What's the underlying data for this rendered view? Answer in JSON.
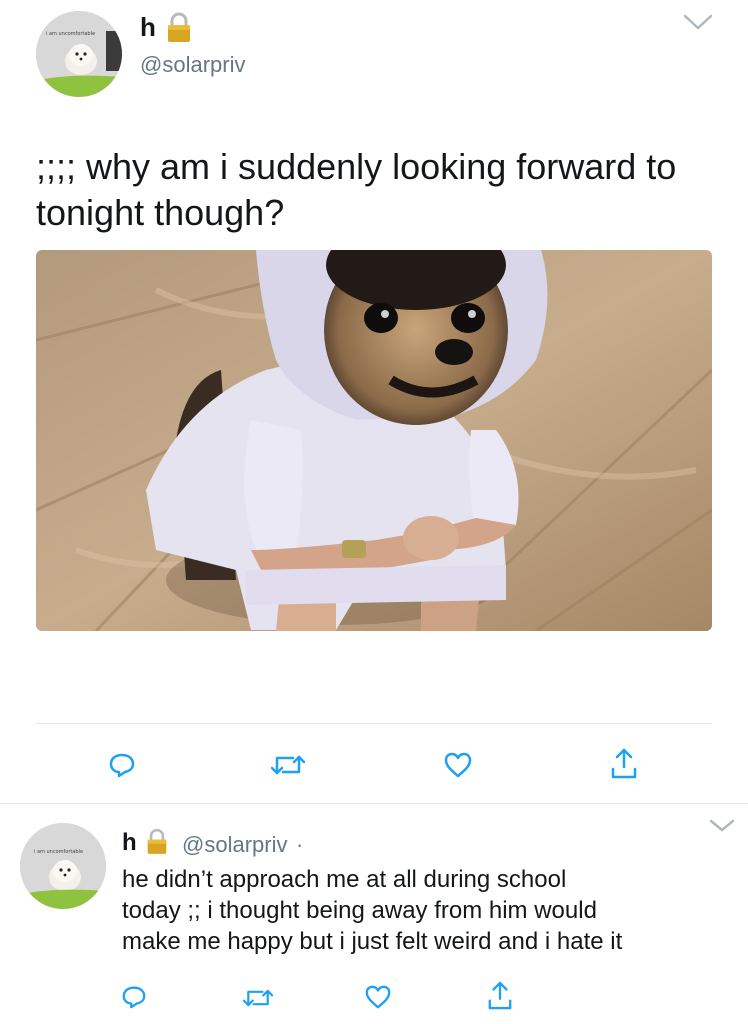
{
  "main_tweet": {
    "display_name": "h",
    "handle": "@solarpriv",
    "avatar_caption": "i am uncomfortable",
    "text_line1": ";;;; why am i suddenly looking forward to",
    "text_line2": "tonight though?",
    "icons": {
      "lock": "lock-icon",
      "menu": "chevron-down-icon",
      "reply": "reply-icon",
      "retweet": "retweet-icon",
      "like": "heart-icon",
      "share": "share-icon"
    },
    "media": {
      "description_icon": "photo"
    }
  },
  "reply_tweet": {
    "display_name": "h",
    "handle": "@solarpriv",
    "separator": "·",
    "avatar_caption": "i am uncomfortable",
    "text_line1": "he didn’t approach me at all during school",
    "text_line2": "today ;; i thought being away from him would",
    "text_line3": "make me happy but i just felt weird and i hate it"
  },
  "colors": {
    "text": "#14171a",
    "secondary": "#657786",
    "icon": "#1da1f2",
    "divider": "#e1e8ed"
  }
}
